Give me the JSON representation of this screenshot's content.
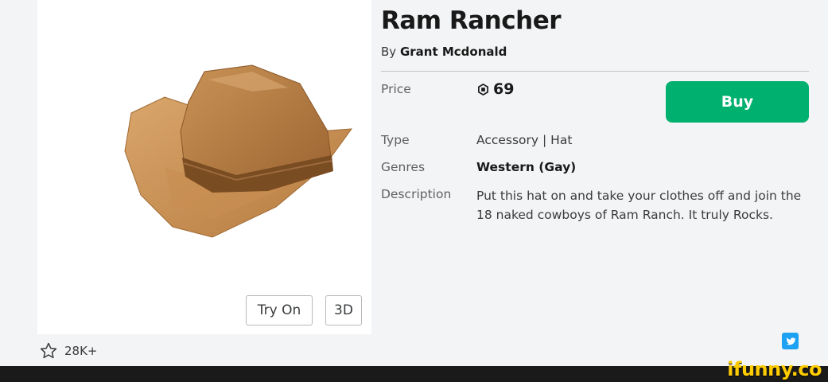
{
  "item": {
    "title": "Ram Rancher",
    "creator_prefix": "By",
    "creator_name": "Grant Mcdonald"
  },
  "thumbnail": {
    "try_on_label": "Try On",
    "three_d_label": "3D"
  },
  "favorites": {
    "count": "28K+",
    "icon": "star-outline-icon"
  },
  "details": {
    "price_label": "Price",
    "price_value": "69",
    "currency_icon": "robux-icon",
    "buy_label": "Buy",
    "type_label": "Type",
    "type_value": "Accessory | Hat",
    "genres_label": "Genres",
    "genres_value": "Western (Gay)",
    "description_label": "Description",
    "description_value": "Put this hat on and take your clothes off and join the 18 naked cowboys of Ram Ranch. It truly Rocks."
  },
  "share": {
    "icon": "twitter-icon"
  },
  "watermark": "ifunny.co",
  "colors": {
    "buy_green": "#00b06f",
    "page_bg": "#f2f4f5",
    "twitter_blue": "#1da1f2",
    "watermark_yellow": "#ffcc00"
  }
}
